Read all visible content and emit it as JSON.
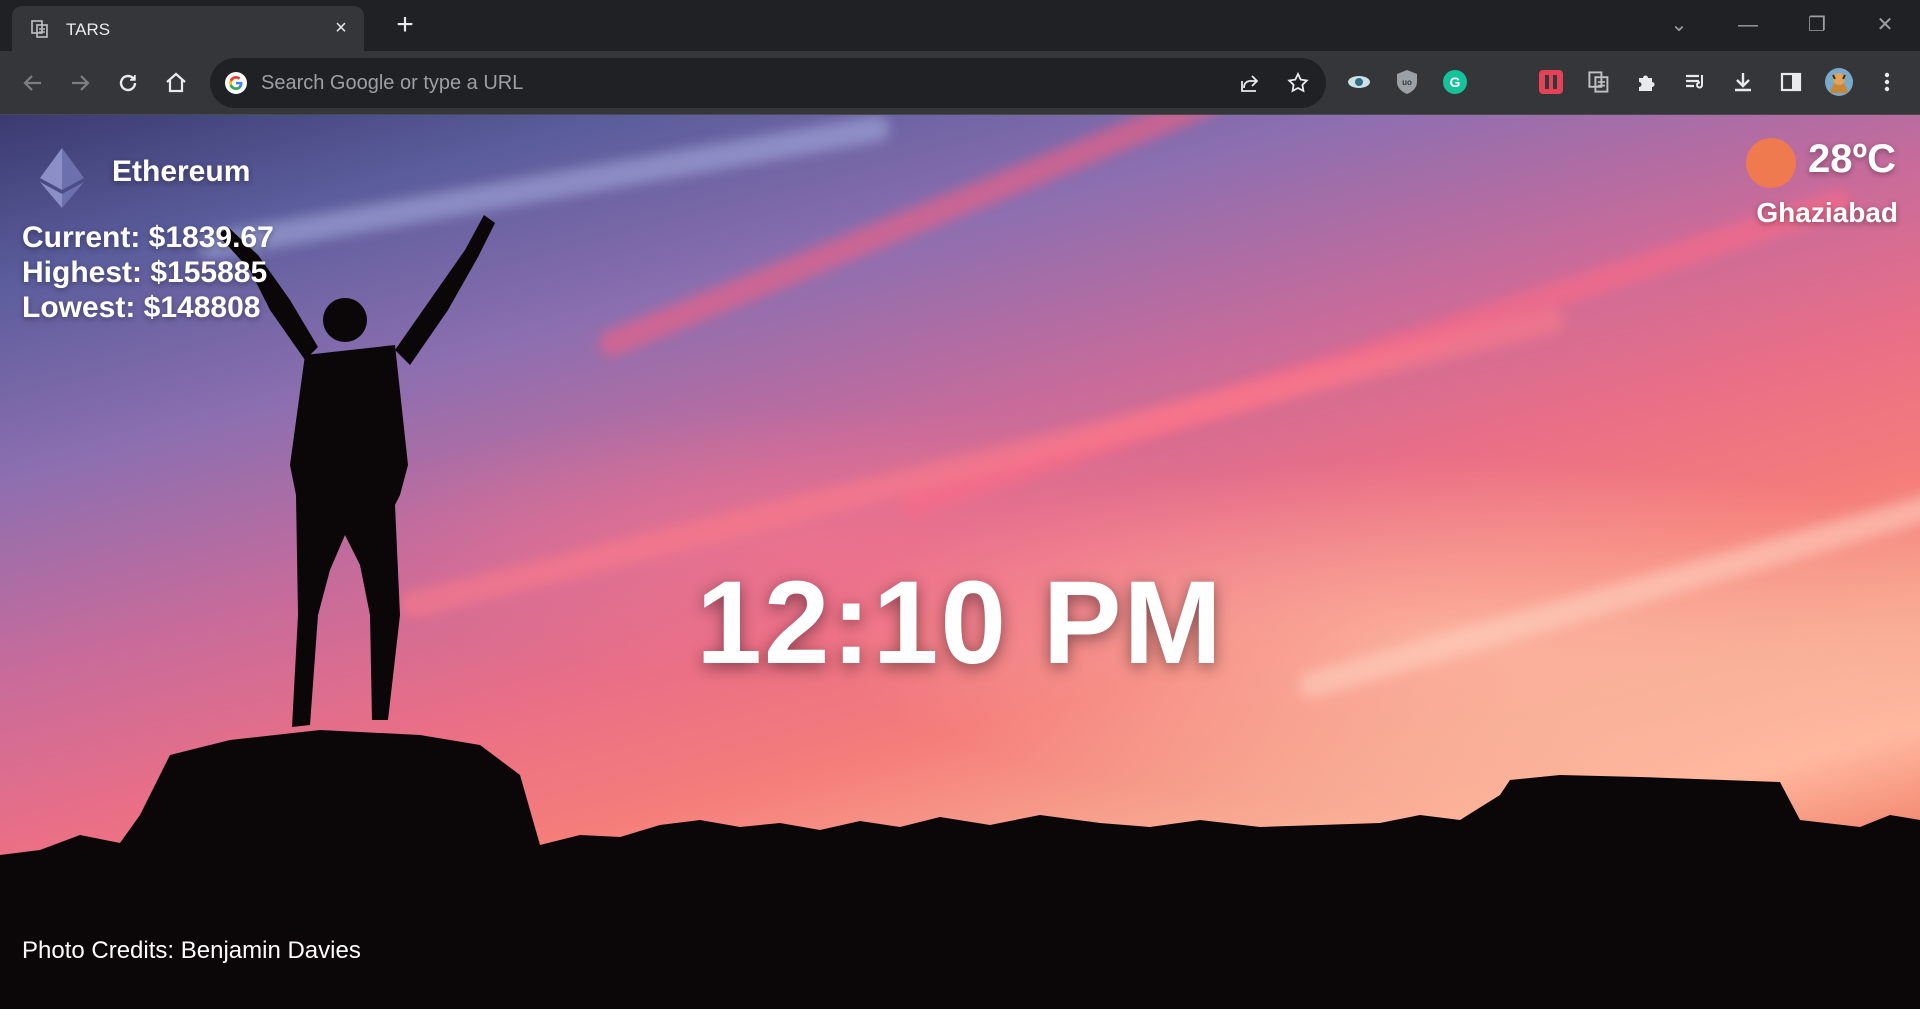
{
  "browser": {
    "tab_title": "TARS",
    "tab_close": "×",
    "new_tab": "+",
    "omnibox_placeholder": "Search Google or type a URL",
    "window_controls": {
      "dropdown": "⌄",
      "minimize": "—",
      "restore": "❐",
      "close": "✕"
    },
    "extension_icons": [
      "eye-icon",
      "ublock-icon",
      "grammarly-icon",
      "todoist-icon",
      "tars-icon",
      "puzzle-icon",
      "reading-list-icon",
      "download-icon",
      "side-panel-icon",
      "avatar",
      "menu-icon"
    ]
  },
  "crypto": {
    "name": "Ethereum",
    "current": "Current: $1839.67",
    "highest": "Highest: $155885",
    "lowest": "Lowest: $148808"
  },
  "weather": {
    "temperature": "28ºC",
    "city": "Ghaziabad",
    "icon_color": "#f07a4f"
  },
  "clock": {
    "time": "12:10 PM"
  },
  "footer": {
    "photo_credits": "Photo Credits: Benjamin Davies"
  },
  "colors": {
    "chrome_dark": "#202124",
    "chrome_toolbar": "#35363a",
    "text_light": "#e8eaed",
    "accent_weather": "#f07a4f"
  }
}
